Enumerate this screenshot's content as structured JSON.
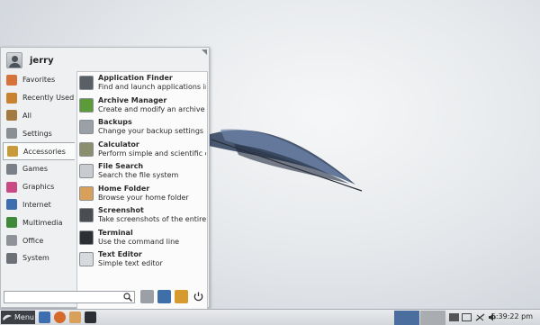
{
  "user": {
    "name": "jerry"
  },
  "categories": [
    {
      "label": "Favorites",
      "icon": "favorites-icon",
      "color": "#d6733a"
    },
    {
      "label": "Recently Used",
      "icon": "recently-used-icon",
      "color": "#c9822f"
    },
    {
      "label": "All",
      "icon": "all-icon",
      "color": "#a37a3f"
    },
    {
      "label": "Settings",
      "icon": "settings-icon",
      "color": "#8a8f95"
    },
    {
      "label": "Accessories",
      "icon": "accessories-icon",
      "color": "#c99a3c"
    },
    {
      "label": "Games",
      "icon": "games-icon",
      "color": "#7a8087"
    },
    {
      "label": "Graphics",
      "icon": "graphics-icon",
      "color": "#c74a86"
    },
    {
      "label": "Internet",
      "icon": "internet-icon",
      "color": "#3d6fb0"
    },
    {
      "label": "Multimedia",
      "icon": "multimedia-icon",
      "color": "#3e8a3a"
    },
    {
      "label": "Office",
      "icon": "office-icon",
      "color": "#8f9399"
    },
    {
      "label": "System",
      "icon": "system-icon",
      "color": "#6c7177"
    }
  ],
  "selected_category": "Accessories",
  "apps": [
    {
      "name": "Application Finder",
      "desc": "Find and launch applications inst...",
      "icon": "app-finder-icon",
      "color": "#5a5f66"
    },
    {
      "name": "Archive Manager",
      "desc": "Create and modify an archive",
      "icon": "archive-icon",
      "color": "#5c9a3a"
    },
    {
      "name": "Backups",
      "desc": "Change your backup settings",
      "icon": "backup-icon",
      "color": "#9aa0a6"
    },
    {
      "name": "Calculator",
      "desc": "Perform simple and scientific calc...",
      "icon": "calculator-icon",
      "color": "#8c8f6e"
    },
    {
      "name": "File Search",
      "desc": "Search the file system",
      "icon": "magnifier-icon",
      "color": "#c8ccd0"
    },
    {
      "name": "Home Folder",
      "desc": "Browse your home folder",
      "icon": "home-folder-icon",
      "color": "#d9a05c"
    },
    {
      "name": "Screenshot",
      "desc": "Take screenshots of the entire scr...",
      "icon": "camera-icon",
      "color": "#4a4e53"
    },
    {
      "name": "Terminal",
      "desc": "Use the command line",
      "icon": "terminal-icon",
      "color": "#2c2f33"
    },
    {
      "name": "Text Editor",
      "desc": "Simple text editor",
      "icon": "text-editor-icon",
      "color": "#d7dadd"
    }
  ],
  "search": {
    "placeholder": ""
  },
  "taskbar": {
    "menu_label": "Menu",
    "clock": "5:39:22 pm"
  },
  "colors": {
    "workspace_active": "#4a6f9e",
    "workspace_inactive": "#a9adb2"
  }
}
